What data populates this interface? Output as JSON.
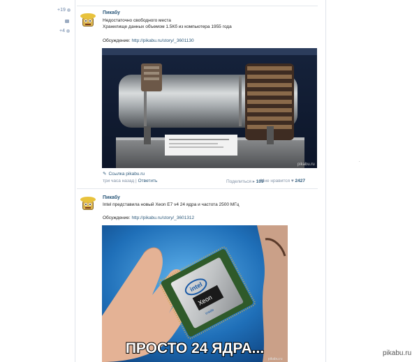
{
  "post1": {
    "rating_up": "+19",
    "rating_comments": "+4",
    "author": "Пикабу",
    "line1": "Недостаточно свободного места",
    "line2": "Хранилище данных объемом 1.5Кб из компьютера 1955 года",
    "discussion_label": "Обсуждение:",
    "discussion_link": "http://pikabu.ru/story/_3601130",
    "image_watermark": "pikabu.ru",
    "source_link": "Ссылка pikabu.ru",
    "time": "три часа назад",
    "reply": "Ответить",
    "share_label": "Поделиться",
    "share_count": "109",
    "like_label": "Мне нравится",
    "like_count": "2427"
  },
  "post2": {
    "author": "Пикабу",
    "line1": "Intel представила новый Xeon E7 v4 24 ядра и частота 2500 МГц",
    "discussion_label": "Обсуждение:",
    "discussion_link": "http://pikabu.ru/story/_3601312",
    "caption": "ПРОСТО 24 ЯДРА...",
    "chip_brand": "intel",
    "chip_model": "Xeon",
    "chip_inside": "inside",
    "image_watermark": "pikabu.ru"
  },
  "page_watermark": "pikabu.ru",
  "colors": {
    "link": "#2b587a",
    "meta": "#7f8fa4",
    "rating": "#6a84a8"
  }
}
